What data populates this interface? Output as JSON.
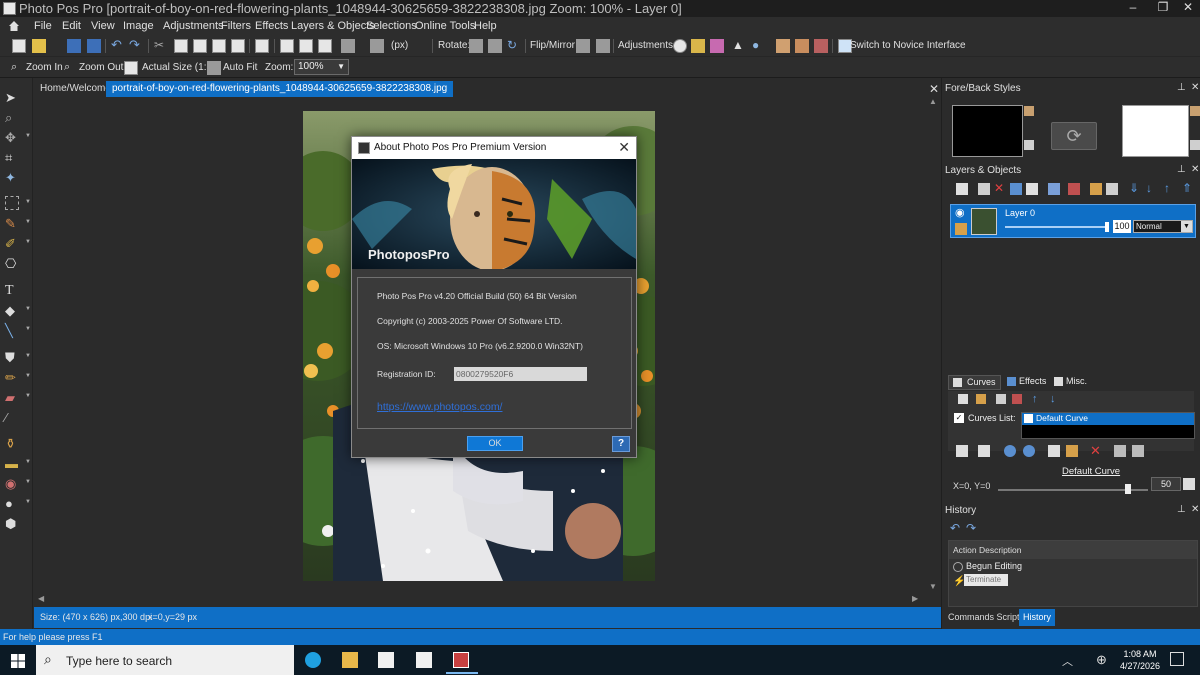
{
  "window": {
    "title": "Photo Pos Pro [portrait-of-boy-on-red-flowering-plants_1048944-30625659-3822238308.jpg  Zoom: 100% - Layer 0]",
    "minimize": "–",
    "maximize": "❐",
    "close": "✕"
  },
  "menu": [
    "File",
    "Edit",
    "View",
    "Image",
    "Adjustments",
    "Filters",
    "Effects",
    "Layers & Objects",
    "Selections",
    "Online Tools",
    "Help"
  ],
  "toolbar": {
    "units": "(px)",
    "rotate_label": "Rotate:",
    "flip_label": "Flip/Mirror",
    "adjustments_label": "Adjustments:",
    "novice_label": "Switch to Novice Interface"
  },
  "toolbar2": {
    "zoom_in": "Zoom In",
    "zoom_out": "Zoom Out",
    "actual_size": "Actual Size (1:1)",
    "auto_fit": "Auto Fit",
    "zoom_label": "Zoom:",
    "zoom_value": "100%"
  },
  "tabs": {
    "home": "Home/Welcome",
    "document": "portrait-of-boy-on-red-flowering-plants_1048944-30625659-3822238308.jpg",
    "close": "✕"
  },
  "about": {
    "title": "About Photo Pos Pro Premium Version",
    "close": "✕",
    "banner_logo": "PhotoposPro",
    "version": "Photo Pos Pro v4.20 Official Build (50) 64 Bit Version",
    "copyright": "Copyright (c) 2003-2025 Power Of Software LTD.",
    "os": "OS: Microsoft Windows 10 Pro (v6.2.9200.0 Win32NT)",
    "reg_label": "Registration ID:",
    "reg_value": "0800279520F6",
    "link": "https://www.photopos.com/",
    "ok": "OK",
    "help": "?"
  },
  "sizebar": {
    "size": "Size: (470 x 626) px,300 dpi",
    "coords": "x=0,y=29 px"
  },
  "panels": {
    "fore_back": "Fore/Back Styles",
    "layers": "Layers & Objects",
    "layer_name": "Layer 0",
    "layer_opacity": "100",
    "blend_mode": "Normal",
    "curves_tab": "Curves",
    "effects_tab": "Effects",
    "misc_tab": "Misc.",
    "curves_list_label": "Curves List:",
    "curve_item": "Default Curve",
    "curve_name": "Default Curve",
    "curve_coords": "X=0, Y=0",
    "curve_value": "50",
    "history": "History",
    "action_header": "Action Description",
    "history_items": [
      "Begun Editing",
      "Terminate"
    ],
    "commands_tab": "Commands Script",
    "history_tab": "History",
    "pin": "⊥",
    "close": "✕"
  },
  "status": "For help please press F1",
  "taskbar": {
    "search_placeholder": "Type here to search",
    "time": "1:08 AM",
    "date": "4/27/2026"
  },
  "colors": {
    "accent": "#0f6fc6",
    "link": "#2f6fd8",
    "dialog_bg": "#3a3a3a",
    "app_bg": "#2b2b2b"
  }
}
